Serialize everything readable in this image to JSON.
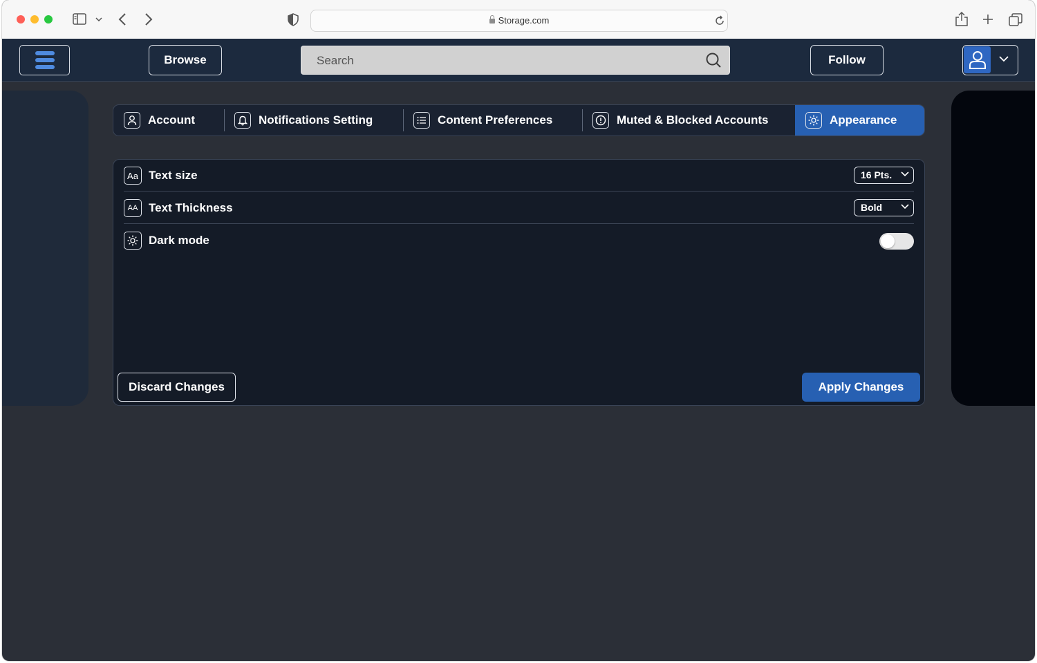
{
  "browser": {
    "url": "Storage.com"
  },
  "nav": {
    "browse_label": "Browse",
    "search_placeholder": "Search",
    "follow_label": "Follow"
  },
  "tabs": [
    {
      "label": "Account",
      "icon": "user-icon",
      "active": false
    },
    {
      "label": "Notifications Setting",
      "icon": "bell-icon",
      "active": false
    },
    {
      "label": "Content Preferences",
      "icon": "list-icon",
      "active": false
    },
    {
      "label": "Muted & Blocked Accounts",
      "icon": "alert-circle-icon",
      "active": false
    },
    {
      "label": "Appearance",
      "icon": "sun-icon",
      "active": true
    }
  ],
  "settings": {
    "text_size": {
      "label": "Text size",
      "icon_text": "Aa",
      "value": "16 Pts."
    },
    "text_thickness": {
      "label": "Text Thickness",
      "icon_text": "AA",
      "value": "Bold"
    },
    "dark_mode": {
      "label": "Dark mode",
      "enabled": false
    }
  },
  "actions": {
    "discard_label": "Discard Changes",
    "apply_label": "Apply Changes"
  },
  "colors": {
    "accent": "#2760b2",
    "nav_bg": "#1c2a3e",
    "page_bg": "#2b2f37",
    "panel_bg": "#141b27"
  }
}
